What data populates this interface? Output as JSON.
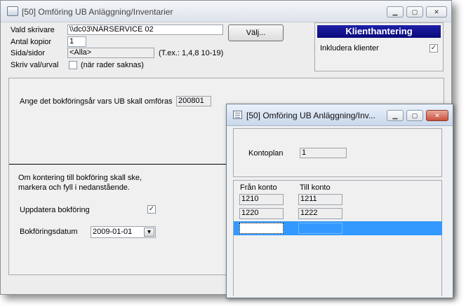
{
  "main_window": {
    "title": "[50]  Omföring UB Anläggning/Inventarier",
    "printer_label": "Vald skrivare",
    "printer_value": "\\\\dc03\\NÄRSERVICE 02",
    "choose_button": "Välj...",
    "copies_label": "Antal kopior",
    "copies_value": "1",
    "pages_label": "Sida/sidor",
    "pages_value": "<Alla>",
    "pages_hint": "(T.ex.: 1,4,8 10-19)",
    "print_selection_label": "Skriv val/urval",
    "print_selection_hint": "(när rader saknas)",
    "print_selection_checked": false
  },
  "client_panel": {
    "title": "Klienthantering",
    "include_label": "Inkludera klienter",
    "include_checked": true,
    "check_mark": "✓"
  },
  "body": {
    "year_label": "Ange det bokföringsår vars UB skall omföras",
    "year_value": "200801",
    "info_line1": "Om kontering till bokföring skall ske,",
    "info_line2": "markera och fyll i nedanstående.",
    "update_label": "Uppdatera bokföring",
    "update_checked": true,
    "date_label": "Bokföringsdatum",
    "date_value": "2009-01-01",
    "date_dropdown_glyph": "▾"
  },
  "child_window": {
    "title": "[50]  Omföring UB Anläggning/Inv...",
    "kontoplan_label": "Kontoplan",
    "kontoplan_value": "1",
    "col_from": "Från konto",
    "col_to": "Till konto",
    "rows": [
      {
        "from": "1210",
        "to": "1211"
      },
      {
        "from": "1220",
        "to": "1222"
      },
      {
        "from": "",
        "to": ""
      }
    ]
  },
  "title_buttons": {
    "minimize": "▁",
    "maximize": "▢",
    "close": "✕"
  },
  "colors": {
    "selection": "#3399ff",
    "client_header": "#0a0a7a"
  }
}
